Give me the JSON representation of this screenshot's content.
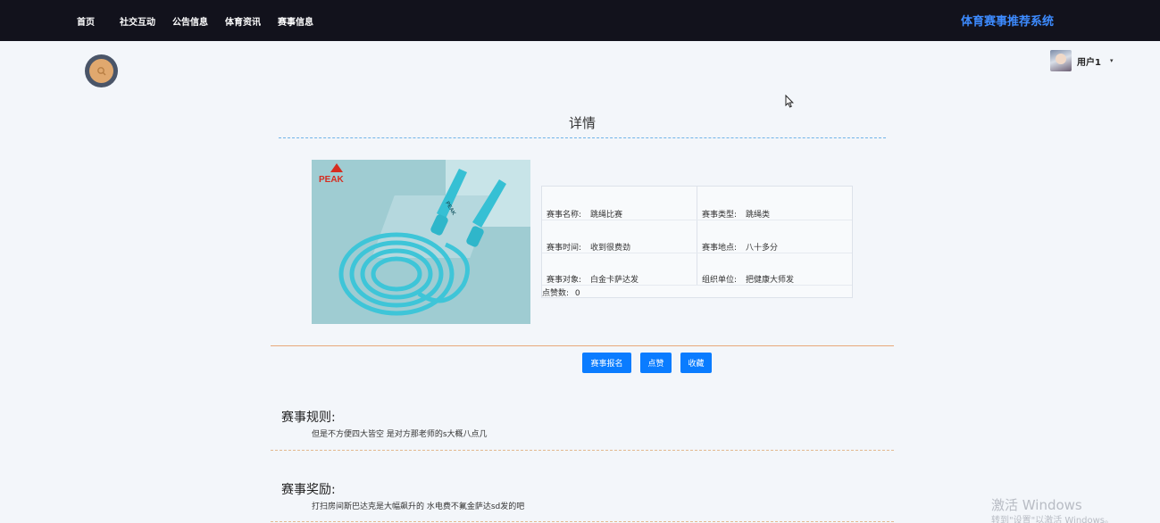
{
  "nav": {
    "items": [
      "首页",
      "社交互动",
      "公告信息",
      "体育资讯",
      "赛事信息"
    ],
    "site_title": "体育赛事推荐系统"
  },
  "user": {
    "name": "用户1",
    "caret": "▾"
  },
  "detail": {
    "heading": "详情",
    "image_logo_text": "PEAK",
    "image_handle_text": "PEAK",
    "fields": [
      {
        "label": "赛事名称:",
        "value": "跳绳比赛"
      },
      {
        "label": "赛事类型:",
        "value": "跳绳类"
      },
      {
        "label": "赛事时间:",
        "value": "收到很费劲"
      },
      {
        "label": "赛事地点:",
        "value": "八十多分"
      },
      {
        "label": "赛事对象:",
        "value": "白金卡萨达发"
      },
      {
        "label": "组织单位:",
        "value": "把健康大师发"
      }
    ],
    "likes_label": "点赞数:",
    "likes_value": "0"
  },
  "buttons": {
    "register": "赛事报名",
    "like": "点赞",
    "favorite": "收藏"
  },
  "sections": {
    "rules_title": "赛事规则:",
    "rules_text": "但是不方便四大皆空 是对方那老师的s大概八点几",
    "rewards_title": "赛事奖励:",
    "rewards_text": "打扫房间斯巴达克是大幅飙升的 水电费不氟金萨达sd发的吧"
  },
  "watermark": {
    "line1": "激活 Windows",
    "line2": "转到\"设置\"以激活 Windows。"
  },
  "colors": {
    "topbar": "#12121c",
    "accent": "#0a7cff",
    "title": "#3d8bff"
  }
}
